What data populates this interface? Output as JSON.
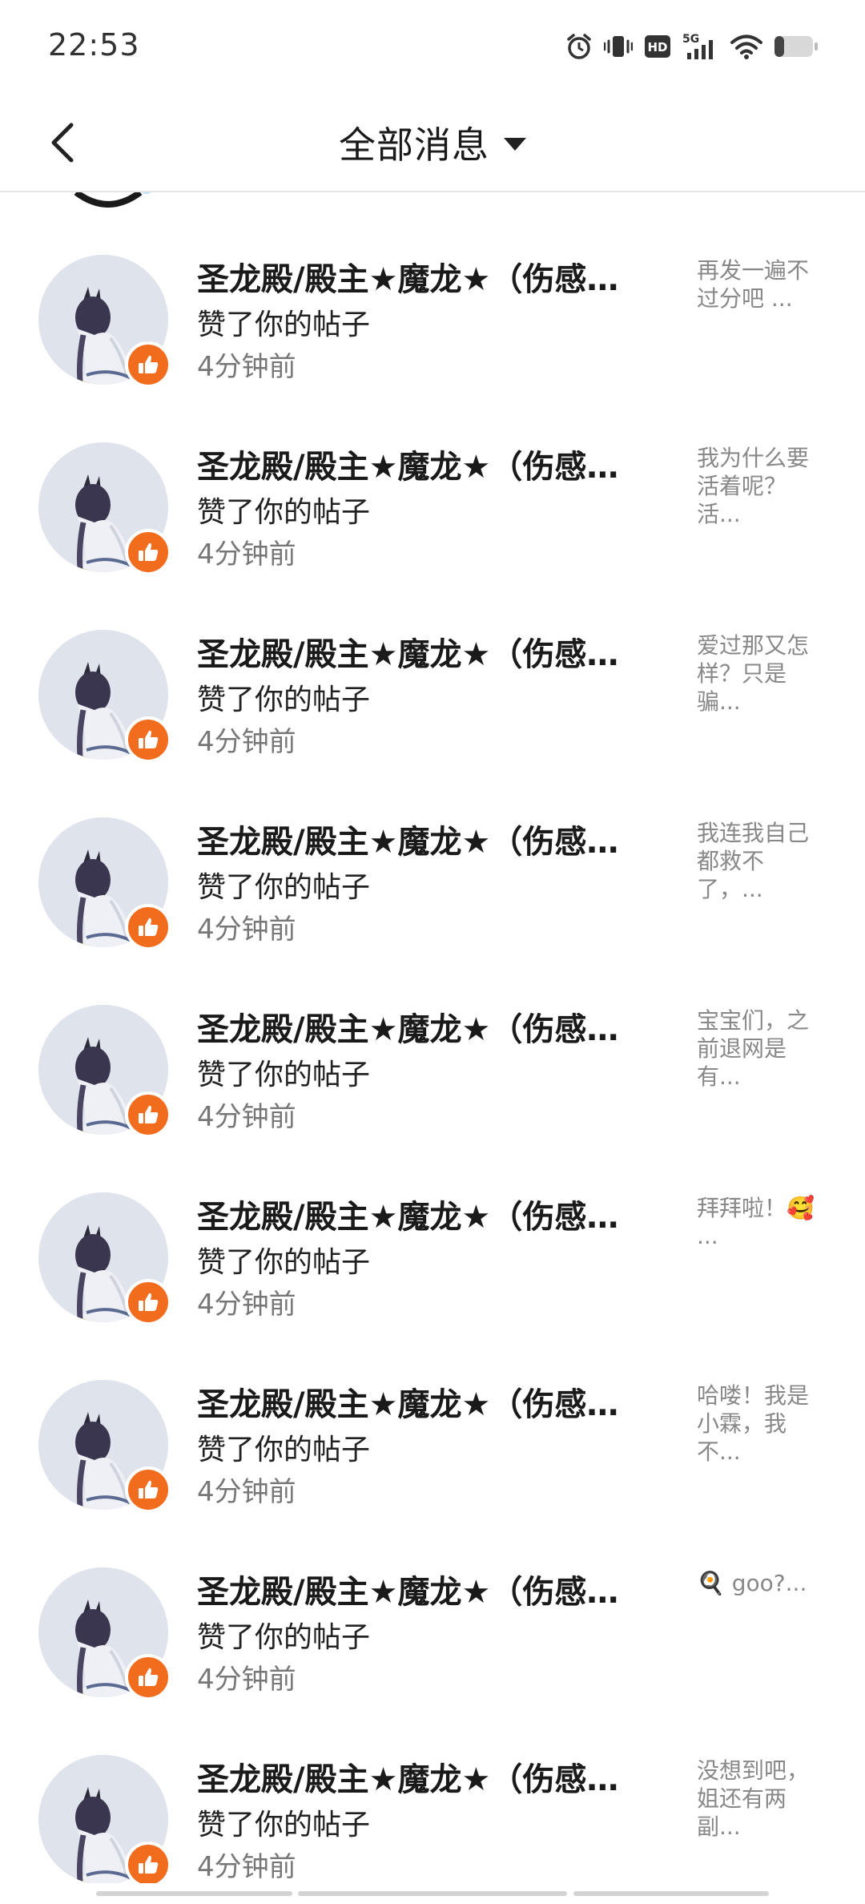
{
  "status_bar": {
    "time": "22:53",
    "network": "5G",
    "hd_badge": "HD",
    "icons": [
      "alarm-icon",
      "vibrate-icon",
      "hd-icon",
      "signal-5g-icon",
      "wifi-icon",
      "battery-icon"
    ]
  },
  "header": {
    "title": "全部消息",
    "back_icon": "chevron-left-icon",
    "dropdown_icon": "caret-down-icon"
  },
  "notifications": [
    {
      "name": "圣龙殿/殿主★魔龙★（伤感…",
      "action": "赞了你的帖子",
      "time": "4分钟前",
      "preview": "再发一遍不过分吧 ..."
    },
    {
      "name": "圣龙殿/殿主★魔龙★（伤感…",
      "action": "赞了你的帖子",
      "time": "4分钟前",
      "preview": "我为什么要活着呢？活..."
    },
    {
      "name": "圣龙殿/殿主★魔龙★（伤感…",
      "action": "赞了你的帖子",
      "time": "4分钟前",
      "preview": "爱过那又怎样？只是骗..."
    },
    {
      "name": "圣龙殿/殿主★魔龙★（伤感…",
      "action": "赞了你的帖子",
      "time": "4分钟前",
      "preview": "我连我自己都救不了，..."
    },
    {
      "name": "圣龙殿/殿主★魔龙★（伤感…",
      "action": "赞了你的帖子",
      "time": "4分钟前",
      "preview": "宝宝们，之前退网是有..."
    },
    {
      "name": "圣龙殿/殿主★魔龙★（伤感…",
      "action": "赞了你的帖子",
      "time": "4分钟前",
      "preview": "拜拜啦！🥰 ..."
    },
    {
      "name": "圣龙殿/殿主★魔龙★（伤感…",
      "action": "赞了你的帖子",
      "time": "4分钟前",
      "preview": "哈喽！我是小霖，我不..."
    },
    {
      "name": "圣龙殿/殿主★魔龙★（伤感…",
      "action": "赞了你的帖子",
      "time": "4分钟前",
      "preview": "🍳 goo?..."
    },
    {
      "name": "圣龙殿/殿主★魔龙★（伤感…",
      "action": "赞了你的帖子",
      "time": "4分钟前",
      "preview": "没想到吧，姐还有两副..."
    }
  ],
  "colors": {
    "like_badge": "#f26c1e",
    "avatar_bg": "#dfe3ec",
    "secondary_text": "#777777",
    "preview_text": "#888888"
  }
}
